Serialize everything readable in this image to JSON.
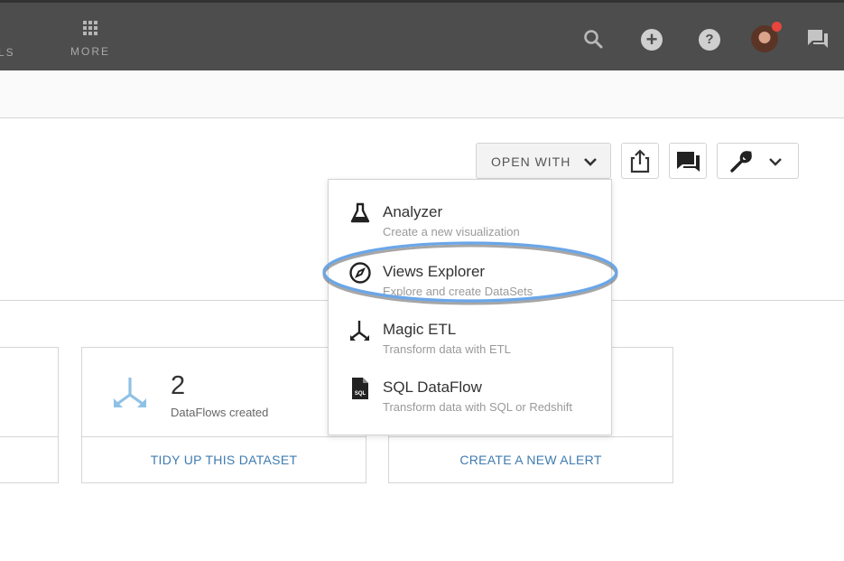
{
  "nav": {
    "partial_label": "LS",
    "more_label": "MORE"
  },
  "toolbar": {
    "open_with_label": "OPEN WITH"
  },
  "dropdown": {
    "items": [
      {
        "title": "Analyzer",
        "subtitle": "Create a new visualization",
        "icon": "beaker-icon"
      },
      {
        "title": "Views Explorer",
        "subtitle": "Explore and create DataSets",
        "icon": "compass-icon"
      },
      {
        "title": "Magic ETL",
        "subtitle": "Transform data with ETL",
        "icon": "etl-arrows-icon"
      },
      {
        "title": "SQL DataFlow",
        "subtitle": "Transform data with SQL or Redshift",
        "icon": "sql-file-icon"
      }
    ],
    "highlighted_item": "Views Explorer"
  },
  "cards": {
    "dataflows": {
      "count": "2",
      "label": "DataFlows created",
      "action": "TIDY UP THIS DATASET"
    },
    "alerts": {
      "action": "CREATE A NEW ALERT"
    }
  },
  "colors": {
    "topbar": "#4d4d4d",
    "link": "#3f7bb0",
    "highlight_ring": "#6aa6e8",
    "notification_dot": "#e8453c"
  }
}
